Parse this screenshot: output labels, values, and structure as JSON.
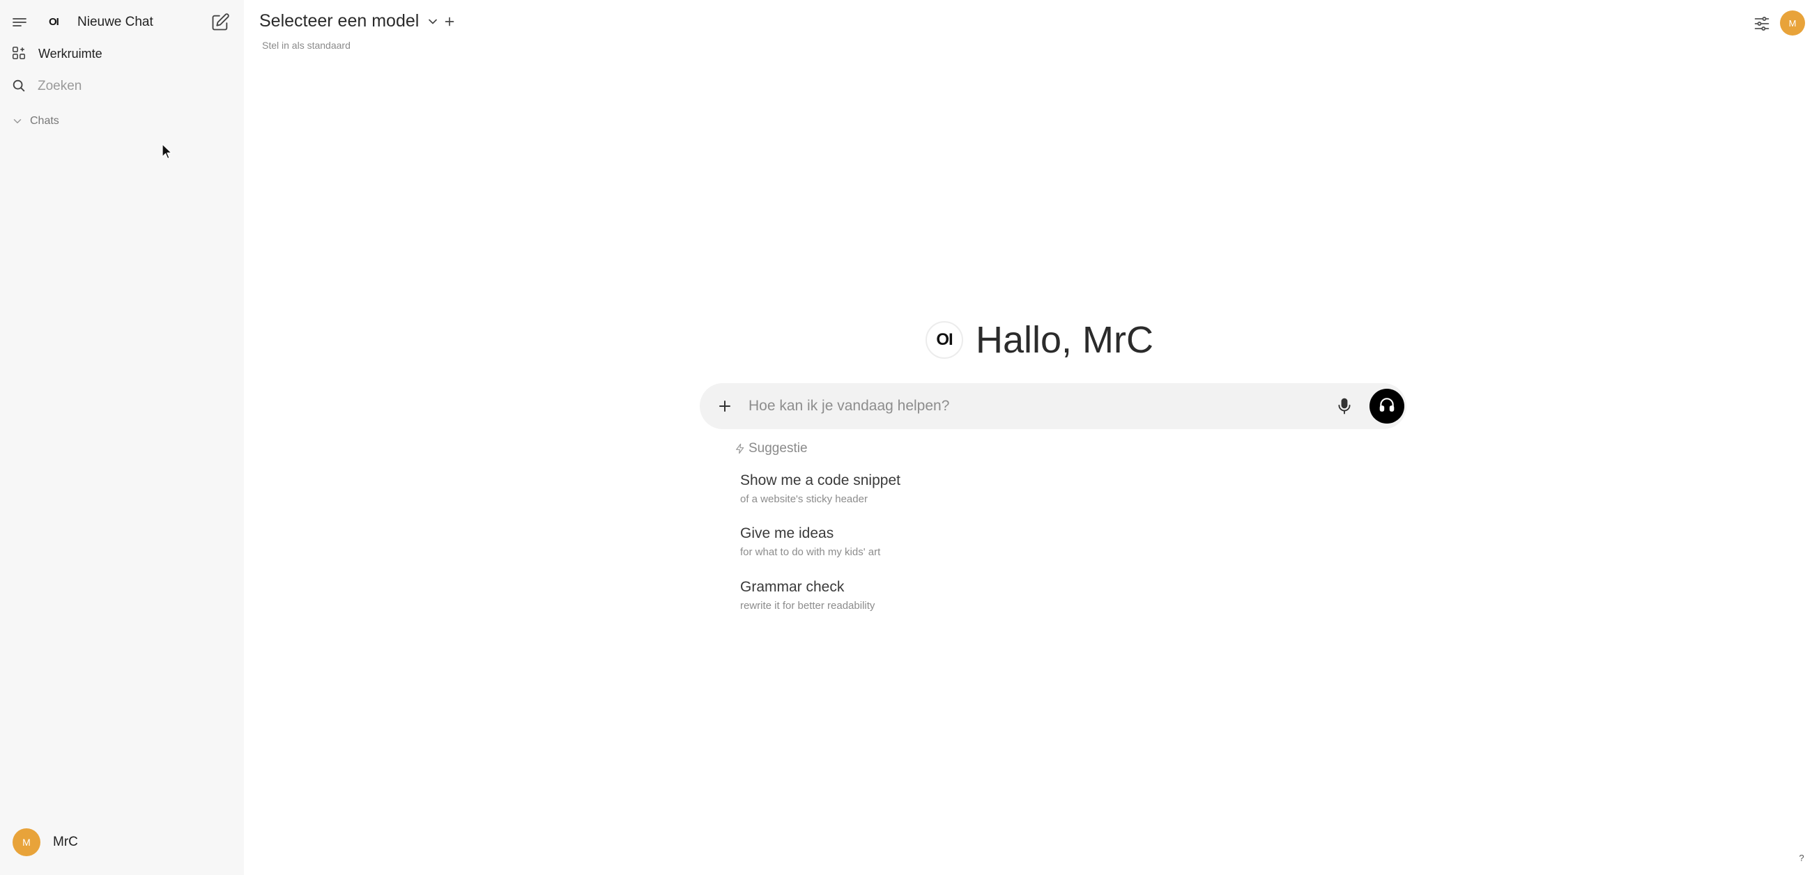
{
  "sidebar": {
    "logo": "OI",
    "new_chat_label": "Nieuwe Chat",
    "workspace_label": "Werkruimte",
    "search_placeholder": "Zoeken",
    "chats_label": "Chats",
    "user": {
      "initial": "M",
      "name": "MrC"
    }
  },
  "header": {
    "model_select_label": "Selecteer een model",
    "set_default_label": "Stel in als standaard",
    "avatar_initial": "M"
  },
  "main": {
    "logo": "OI",
    "greeting": "Hallo, MrC",
    "input_placeholder": "Hoe kan ik je vandaag helpen?",
    "suggestion_heading": "Suggestie",
    "suggestions": [
      {
        "title": "Show me a code snippet",
        "subtitle": "of a website's sticky header"
      },
      {
        "title": "Give me ideas",
        "subtitle": "for what to do with my kids' art"
      },
      {
        "title": "Grammar check",
        "subtitle": "rewrite it for better readability"
      }
    ],
    "help_label": "?"
  },
  "colors": {
    "sidebar_bg": "#f7f7f7",
    "avatar": "#e8a33a",
    "composer_bg": "#f2f2f2",
    "voice_button": "#000000"
  },
  "icons": [
    "menu-icon",
    "edit-icon",
    "workspace-icon",
    "search-icon",
    "chevron-down-icon",
    "plus-icon",
    "sliders-icon",
    "mic-icon",
    "headphones-icon",
    "bolt-icon"
  ]
}
